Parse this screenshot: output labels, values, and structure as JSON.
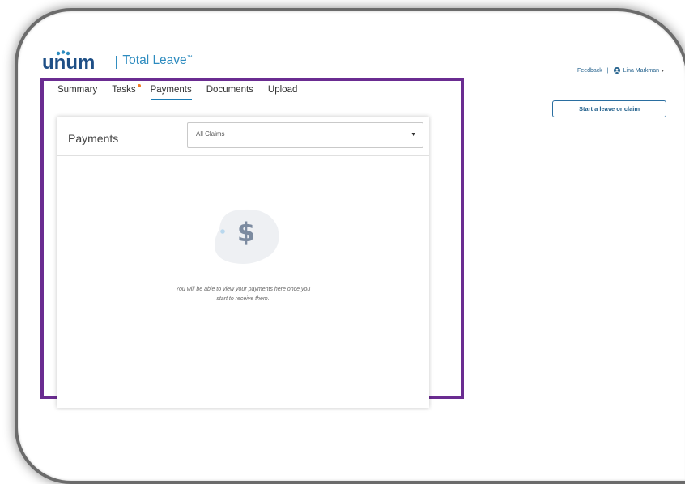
{
  "header": {
    "logo_text": "unum",
    "divider": "|",
    "product_name": "Total Leave",
    "trademark": "™"
  },
  "top_right": {
    "feedback_label": "Feedback",
    "separator": "|",
    "user_name": "Lina Markman",
    "user_icon": "user-circle-icon",
    "caret_icon": "caret-down-icon"
  },
  "actions": {
    "start_leave_label": "Start a leave or claim"
  },
  "tabs": [
    {
      "label": "Summary",
      "active": false,
      "badge": false
    },
    {
      "label": "Tasks",
      "active": false,
      "badge": true
    },
    {
      "label": "Payments",
      "active": true,
      "badge": false
    },
    {
      "label": "Documents",
      "active": false,
      "badge": false
    },
    {
      "label": "Upload",
      "active": false,
      "badge": false
    }
  ],
  "payments": {
    "title": "Payments",
    "filter_value": "All Claims",
    "empty_icon": "dollar-icon",
    "empty_line1": "You will be able to view your payments here once you",
    "empty_line2": "start to receive them."
  },
  "colors": {
    "brand_blue": "#2d8bbf",
    "link_blue": "#1f5e8a",
    "highlight_purple": "#6a2c91",
    "badge_orange": "#f07a20",
    "active_tab_underline": "#1b7ab3"
  }
}
